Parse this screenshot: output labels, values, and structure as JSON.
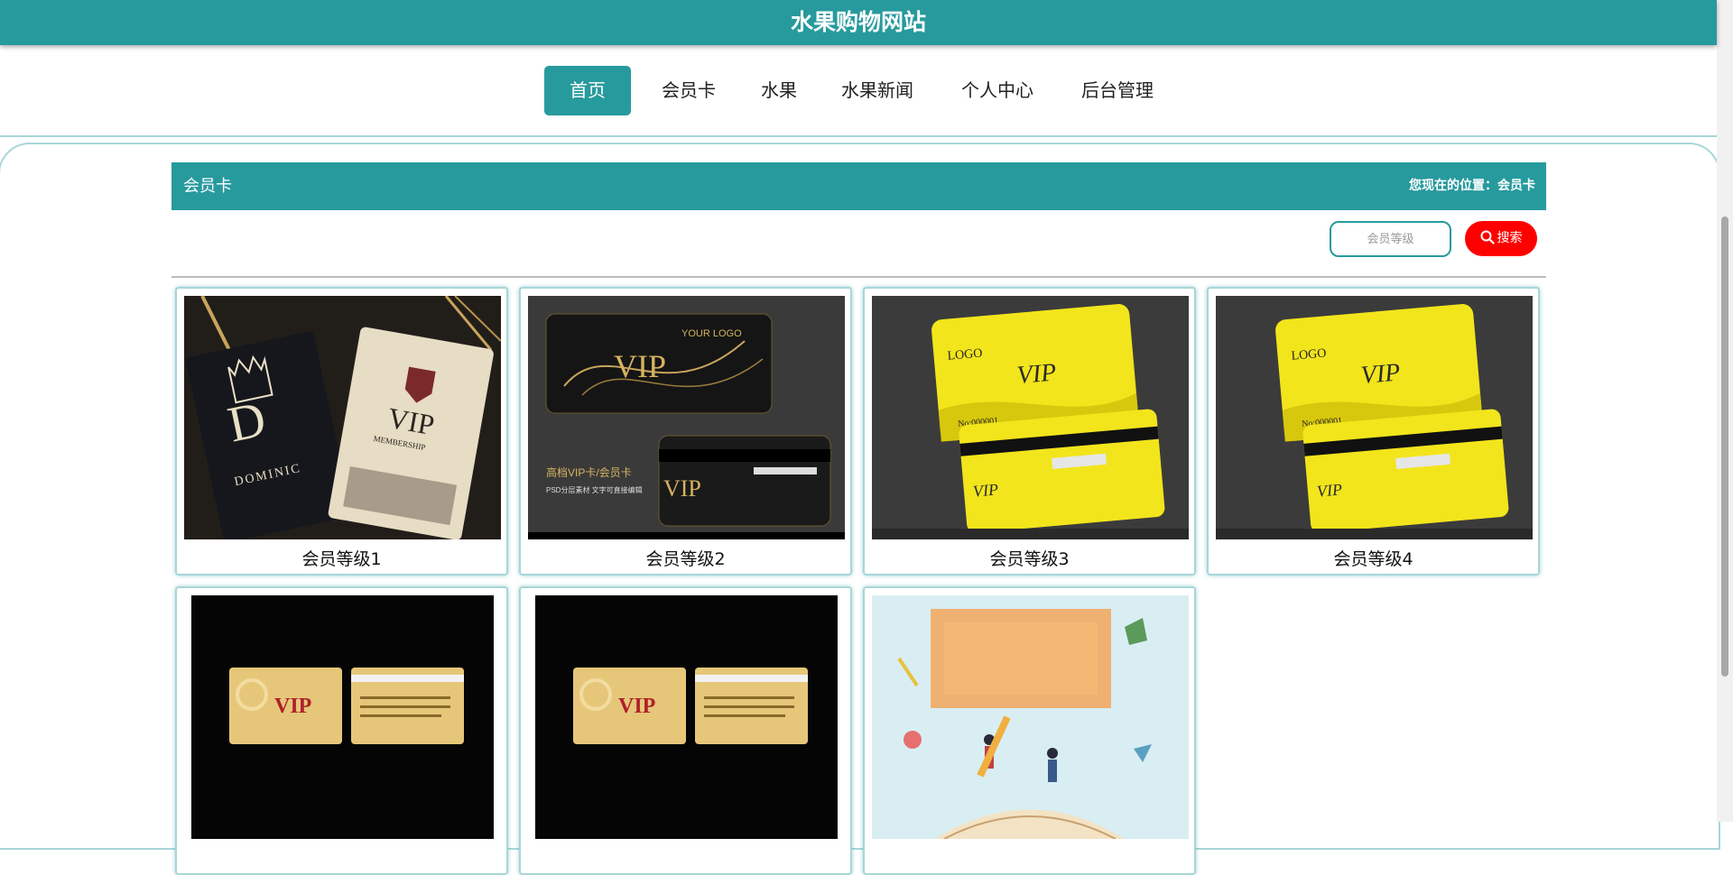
{
  "site": {
    "title": "水果购物网站"
  },
  "nav": {
    "items": [
      {
        "label": "首页",
        "active": true
      },
      {
        "label": "会员卡",
        "active": false
      },
      {
        "label": "水果",
        "active": false
      },
      {
        "label": "水果新闻",
        "active": false
      },
      {
        "label": "个人中心",
        "active": false
      },
      {
        "label": "后台管理",
        "active": false
      }
    ]
  },
  "section": {
    "title": "会员卡",
    "breadcrumb": "您现在的位置：会员卡"
  },
  "search": {
    "placeholder": "会员等级",
    "value": "",
    "button_label": "搜索"
  },
  "cards": [
    {
      "title": "会员等级1"
    },
    {
      "title": "会员等级2"
    },
    {
      "title": "会员等级3"
    },
    {
      "title": "会员等级4"
    },
    {
      "title": ""
    },
    {
      "title": ""
    },
    {
      "title": ""
    }
  ],
  "colors": {
    "brand": "#279a9d",
    "search_button": "#ff0000"
  }
}
